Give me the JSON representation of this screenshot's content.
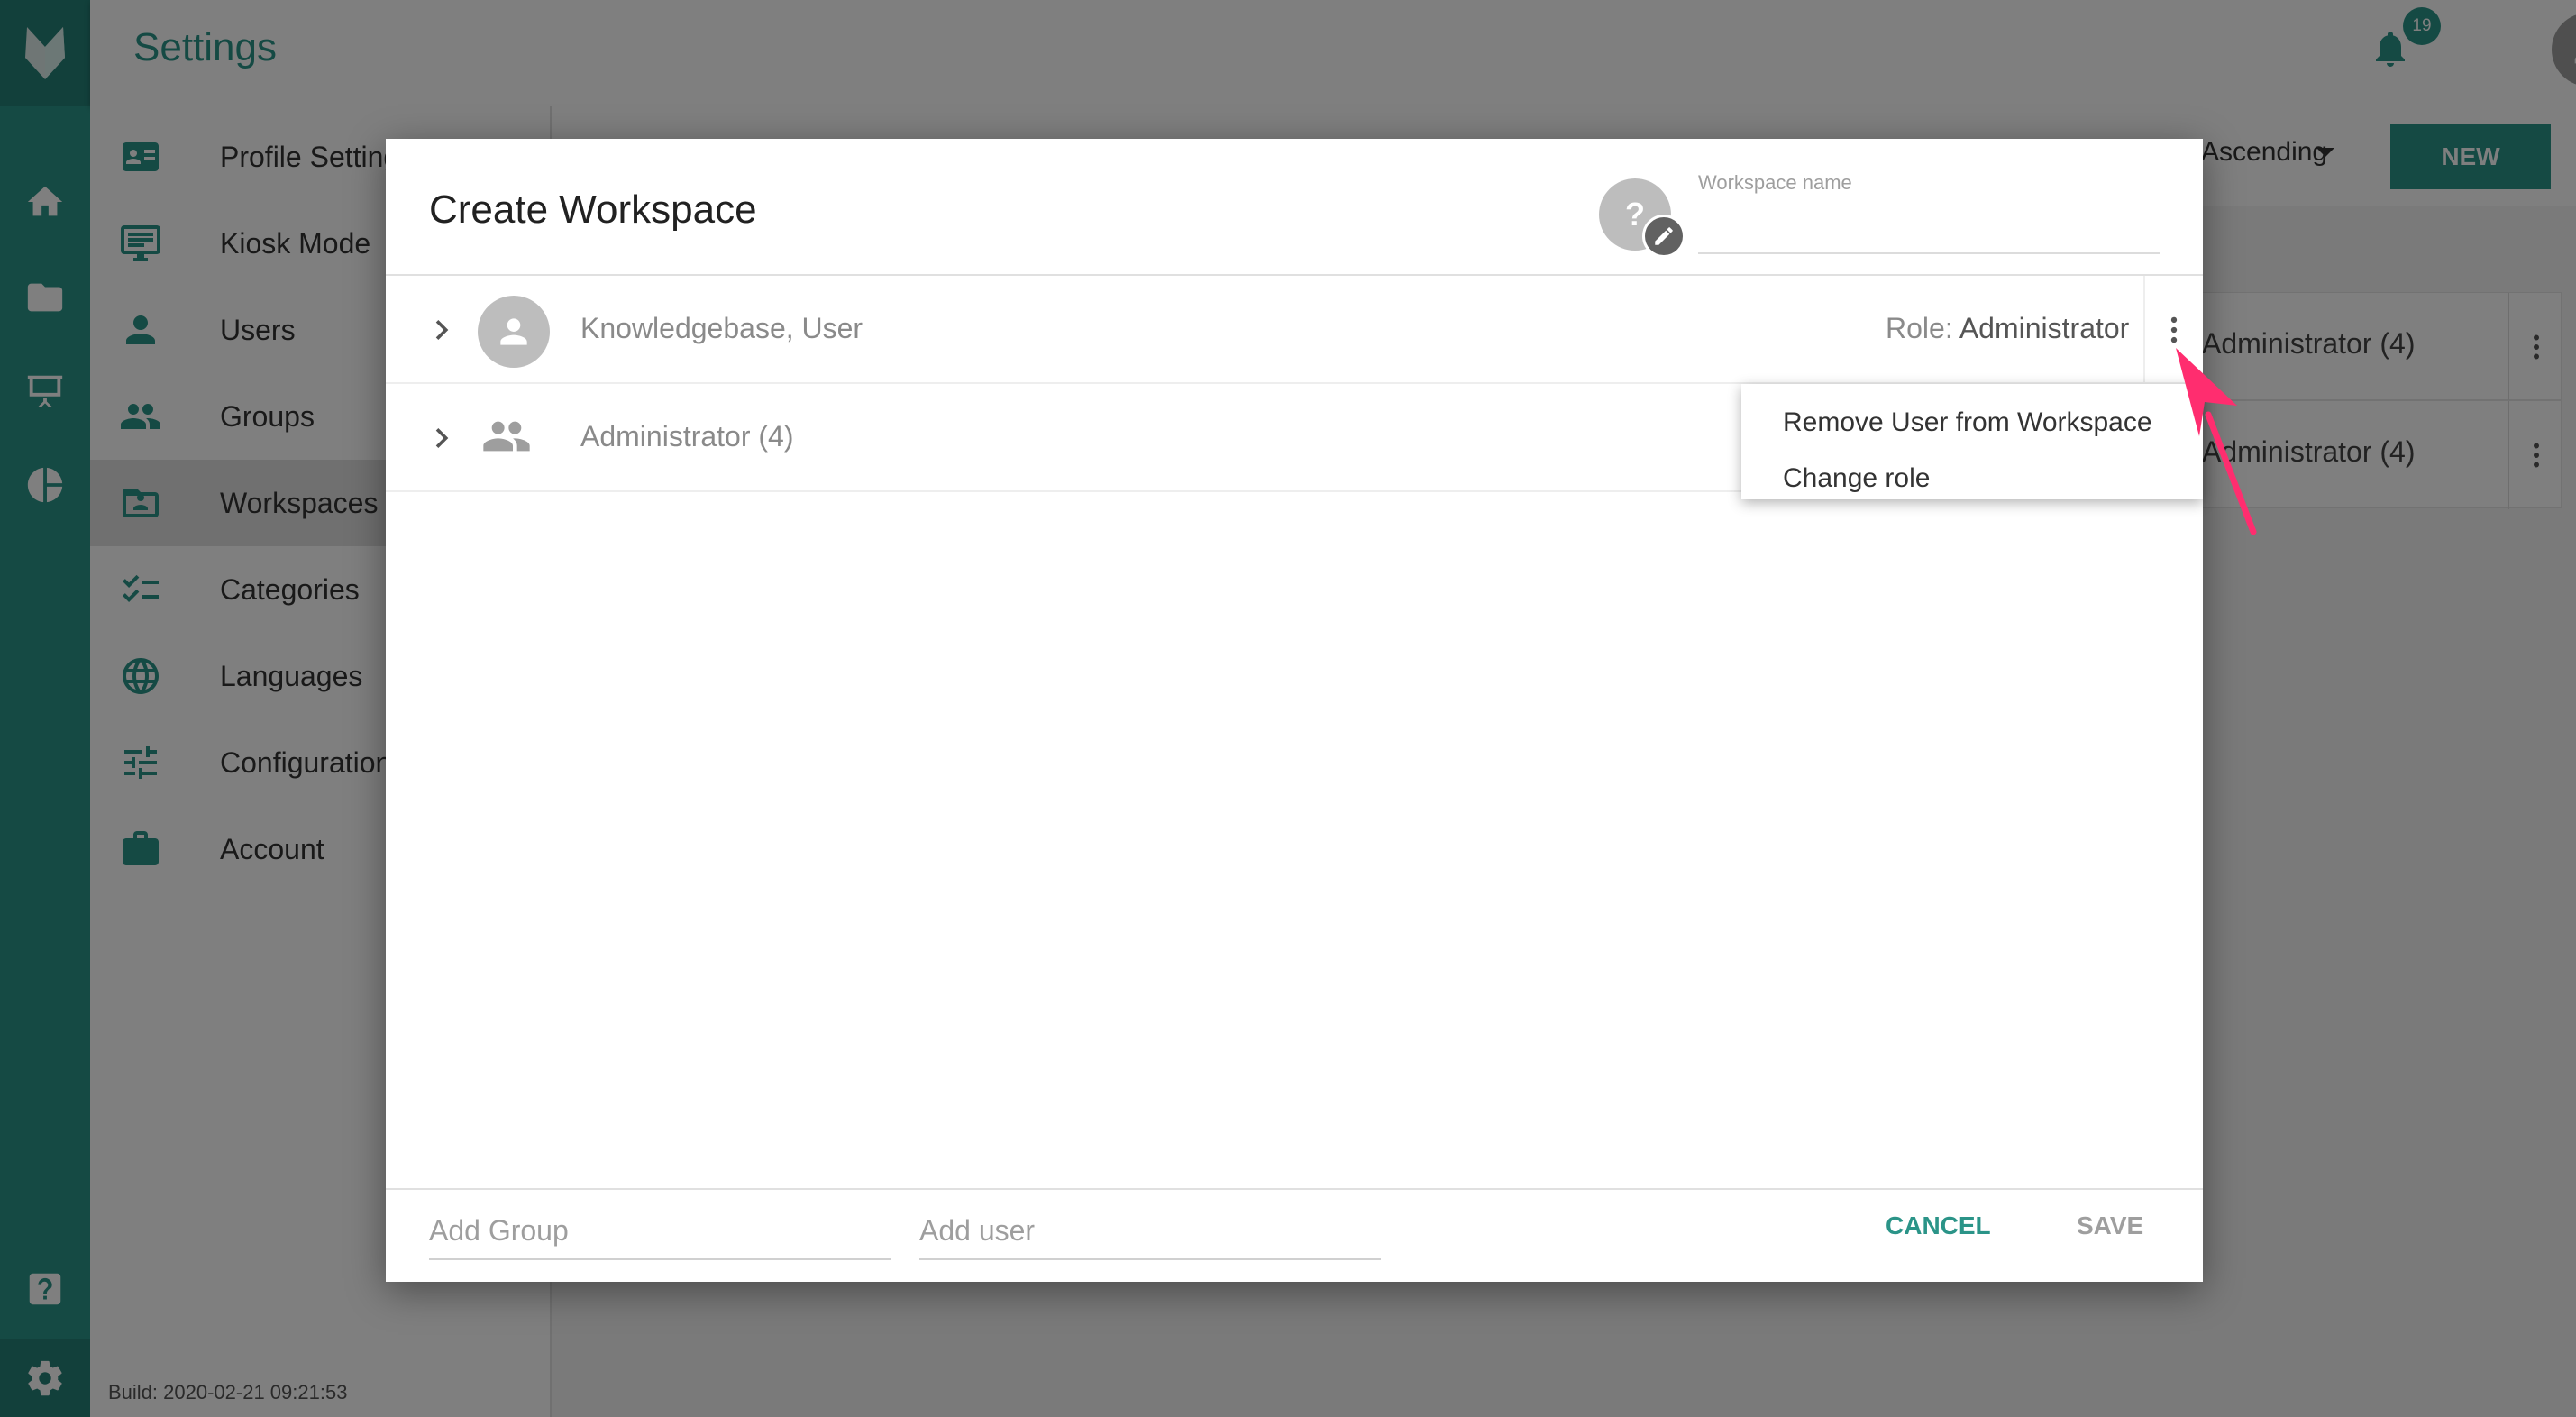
{
  "app": {
    "title": "Settings",
    "notification_count": "19"
  },
  "rail": {
    "icons": [
      "home-icon",
      "folder-icon",
      "presentation-icon",
      "pie-chart-icon",
      "help-icon",
      "gear-icon"
    ]
  },
  "sidebar": {
    "items": [
      {
        "label": "Profile Settings",
        "icon": "id-card-icon"
      },
      {
        "label": "Kiosk Mode",
        "icon": "monitor-icon"
      },
      {
        "label": "Users",
        "icon": "person-icon"
      },
      {
        "label": "Groups",
        "icon": "people-icon"
      },
      {
        "label": "Workspaces",
        "icon": "workspace-icon",
        "active": true
      },
      {
        "label": "Categories",
        "icon": "checklist-icon"
      },
      {
        "label": "Languages",
        "icon": "globe-icon"
      },
      {
        "label": "Configuration",
        "icon": "sliders-icon"
      },
      {
        "label": "Account",
        "icon": "briefcase-icon"
      }
    ],
    "build": "Build: 2020-02-21 09:21:53"
  },
  "content": {
    "sort_label": "Ascending",
    "new_button": "NEW",
    "cards": [
      {
        "text": "Administrator (4)"
      },
      {
        "text": "Administrator (4)"
      }
    ]
  },
  "dialog": {
    "title": "Create Workspace",
    "icon_placeholder": "?",
    "name_label": "Workspace name",
    "name_value": "",
    "rows": [
      {
        "label": "Knowledgebase, User",
        "type": "user",
        "role_key": "Role:",
        "role_value": "Administrator"
      },
      {
        "label": "Administrator (4)",
        "type": "group"
      }
    ],
    "menu": {
      "items": [
        "Remove User from Workspace",
        "Change role"
      ]
    },
    "footer": {
      "add_group_placeholder": "Add Group",
      "add_user_placeholder": "Add user",
      "cancel": "CANCEL",
      "save": "SAVE"
    }
  },
  "colors": {
    "primary": "#2b9488",
    "accent_arrow": "#ff2d6f"
  }
}
